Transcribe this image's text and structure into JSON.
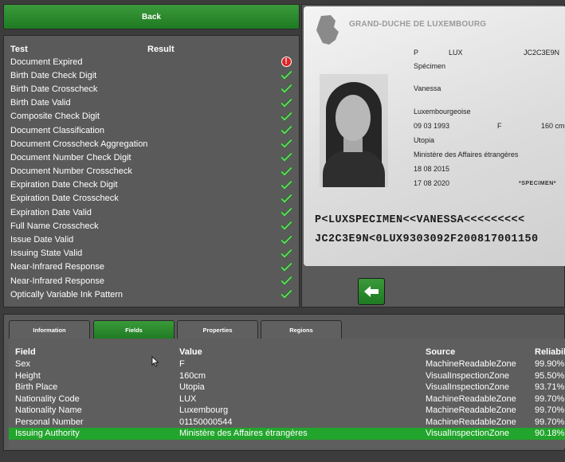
{
  "back_button": {
    "label": "Back"
  },
  "tests": {
    "header_test": "Test",
    "header_result": "Result",
    "rows": [
      {
        "name": "Document Expired",
        "result": "warning"
      },
      {
        "name": "Birth Date Check Digit",
        "result": "pass"
      },
      {
        "name": "Birth Date Crosscheck",
        "result": "pass"
      },
      {
        "name": "Birth Date Valid",
        "result": "pass"
      },
      {
        "name": "Composite Check Digit",
        "result": "pass"
      },
      {
        "name": "Document Classification",
        "result": "pass"
      },
      {
        "name": "Document Crosscheck Aggregation",
        "result": "pass"
      },
      {
        "name": "Document Number Check Digit",
        "result": "pass"
      },
      {
        "name": "Document Number Crosscheck",
        "result": "pass"
      },
      {
        "name": "Expiration Date Check Digit",
        "result": "pass"
      },
      {
        "name": "Expiration Date Crosscheck",
        "result": "pass"
      },
      {
        "name": "Expiration Date Valid",
        "result": "pass"
      },
      {
        "name": "Full Name Crosscheck",
        "result": "pass"
      },
      {
        "name": "Issue Date Valid",
        "result": "pass"
      },
      {
        "name": "Issuing State Valid",
        "result": "pass"
      },
      {
        "name": "Near-Infrared Response",
        "result": "pass"
      },
      {
        "name": "Near-Infrared Response",
        "result": "pass"
      },
      {
        "name": "Optically Variable Ink Pattern",
        "result": "pass"
      }
    ],
    "warning_glyph": "!"
  },
  "id_card": {
    "country": "GRAND-DUCHE DE LUXEMBOURG",
    "type": "P",
    "code": "LUX",
    "number": "JC2C3E9N",
    "surname": "Spécimen",
    "given_name": "Vanessa",
    "nationality": "Luxembourgeoise",
    "birth_date": "09 03 1993",
    "sex": "F",
    "height": "160 cm",
    "birth_place": "Utopia",
    "authority": "Ministère des Affaires étrangères",
    "issue_date": "18 08 2015",
    "expiry_date": "17 08 2020",
    "stamp": "*SPECIMEN*",
    "mrz_line1": "P<LUXSPECIMEN<<VANESSA<<<<<<<<<",
    "mrz_line2": "JC2C3E9N<0LUX9303092F200817001150"
  },
  "tabs": [
    {
      "label": "Information",
      "active": false
    },
    {
      "label": "Fields",
      "active": true
    },
    {
      "label": "Properties",
      "active": false
    },
    {
      "label": "Regions",
      "active": false
    }
  ],
  "fields_table": {
    "headers": {
      "field": "Field",
      "value": "Value",
      "source": "Source",
      "reliability": "Reliabili"
    },
    "rows": [
      {
        "field": "Sex",
        "value": "F",
        "source": "MachineReadableZone",
        "reliability": "99.90%"
      },
      {
        "field": "Height",
        "value": "160cm",
        "source": "VisualInspectionZone",
        "reliability": "95.50%"
      },
      {
        "field": "Birth Place",
        "value": "Utopia",
        "source": "VisualInspectionZone",
        "reliability": "93.71%"
      },
      {
        "field": "Nationality Code",
        "value": "LUX",
        "source": "MachineReadableZone",
        "reliability": "99.70%"
      },
      {
        "field": "Nationality Name",
        "value": "Luxembourg",
        "source": "MachineReadableZone",
        "reliability": "99.70%"
      },
      {
        "field": "Personal Number",
        "value": "01150000544",
        "source": "MachineReadableZone",
        "reliability": "99.70%"
      },
      {
        "field": "Issuing Authority",
        "value": "Ministère des Affaires étrangères",
        "source": "VisualInspectionZone",
        "reliability": "90.18%",
        "selected": true
      }
    ]
  },
  "colors": {
    "accent_green": "#22a52c",
    "panel_gray": "#5a5a5a",
    "warning_red": "#e02424"
  },
  "icons": {
    "back_arrow": "arrow-left-icon",
    "pass": "checkmark-icon",
    "warning": "warning-icon",
    "emblem": "luxembourg-map-icon"
  }
}
